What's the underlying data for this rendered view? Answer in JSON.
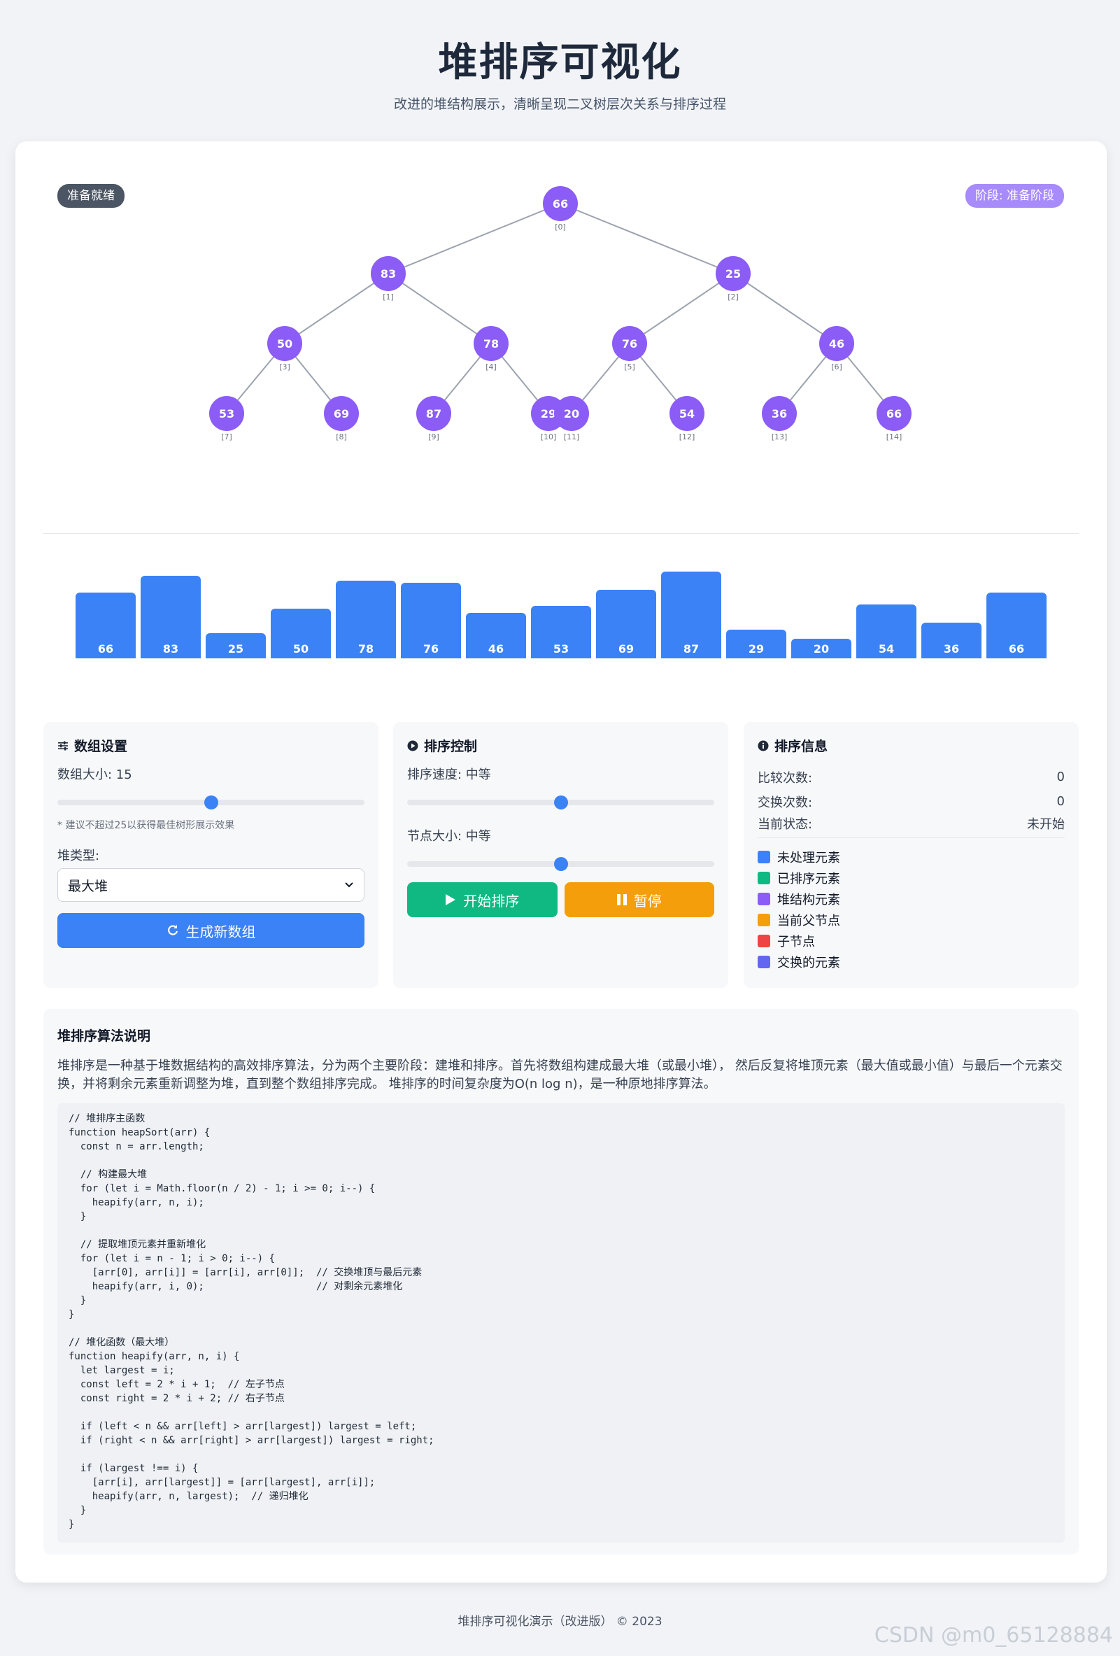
{
  "header": {
    "title": "堆排序可视化",
    "subtitle": "改进的堆结构展示，清晰呈现二叉树层次关系与排序过程"
  },
  "tree": {
    "status_badge": "准备就绪",
    "phase_badge": "阶段: 准备阶段",
    "node_color": "#8b5cf6",
    "edge_color": "#9ca3af",
    "nodes": [
      {
        "value": "66",
        "index": "[0]"
      },
      {
        "value": "83",
        "index": "[1]"
      },
      {
        "value": "25",
        "index": "[2]"
      },
      {
        "value": "50",
        "index": "[3]"
      },
      {
        "value": "78",
        "index": "[4]"
      },
      {
        "value": "76",
        "index": "[5]"
      },
      {
        "value": "46",
        "index": "[6]"
      },
      {
        "value": "53",
        "index": "[7]"
      },
      {
        "value": "69",
        "index": "[8]"
      },
      {
        "value": "87",
        "index": "[9]"
      },
      {
        "value": "29",
        "index": "[10]"
      },
      {
        "value": "20",
        "index": "[11]"
      },
      {
        "value": "54",
        "index": "[12]"
      },
      {
        "value": "36",
        "index": "[13]"
      },
      {
        "value": "66",
        "index": "[14]"
      }
    ]
  },
  "array_values": [
    66,
    83,
    25,
    50,
    78,
    76,
    46,
    53,
    69,
    87,
    29,
    20,
    54,
    36,
    66
  ],
  "bar_color": "#3b82f6",
  "settings": {
    "title": "数组设置",
    "size_label": "数组大小: 15",
    "size_value": 15,
    "size_max": 30,
    "hint": "* 建议不超过25以获得最佳树形展示效果",
    "heap_type_label": "堆类型:",
    "heap_type_value": "最大堆",
    "generate_button": "生成新数组"
  },
  "controls": {
    "title": "排序控制",
    "speed_label": "排序速度: 中等",
    "speed_level": 0.5,
    "node_size_label": "节点大小: 中等",
    "node_size_level": 0.5,
    "start_button": "开始排序",
    "pause_button": "暂停",
    "start_color": "#10b981",
    "pause_color": "#f59e0b"
  },
  "info": {
    "title": "排序信息",
    "comparisons_label": "比较次数:",
    "comparisons_value": "0",
    "swaps_label": "交换次数:",
    "swaps_value": "0",
    "state_label": "当前状态:",
    "state_value": "未开始",
    "legend": [
      {
        "label": "未处理元素",
        "color": "#3b82f6"
      },
      {
        "label": "已排序元素",
        "color": "#10b981"
      },
      {
        "label": "堆结构元素",
        "color": "#8b5cf6"
      },
      {
        "label": "当前父节点",
        "color": "#f59e0b"
      },
      {
        "label": "子节点",
        "color": "#ef4444"
      },
      {
        "label": "交换的元素",
        "color": "#6366f1"
      }
    ]
  },
  "algorithm": {
    "title": "堆排序算法说明",
    "description": "堆排序是一种基于堆数据结构的高效排序算法，分为两个主要阶段：建堆和排序。首先将数组构建成最大堆（或最小堆）， 然后反复将堆顶元素（最大值或最小值）与最后一个元素交换，并将剩余元素重新调整为堆，直到整个数组排序完成。 堆排序的时间复杂度为O(n log n)，是一种原地排序算法。",
    "code": "// 堆排序主函数\nfunction heapSort(arr) {\n  const n = arr.length;\n\n  // 构建最大堆\n  for (let i = Math.floor(n / 2) - 1; i >= 0; i--) {\n    heapify(arr, n, i);\n  }\n\n  // 提取堆顶元素并重新堆化\n  for (let i = n - 1; i > 0; i--) {\n    [arr[0], arr[i]] = [arr[i], arr[0]];  // 交换堆顶与最后元素\n    heapify(arr, i, 0);                   // 对剩余元素堆化\n  }\n}\n\n// 堆化函数（最大堆）\nfunction heapify(arr, n, i) {\n  let largest = i;\n  const left = 2 * i + 1;  // 左子节点\n  const right = 2 * i + 2; // 右子节点\n\n  if (left < n && arr[left] > arr[largest]) largest = left;\n  if (right < n && arr[right] > arr[largest]) largest = right;\n\n  if (largest !== i) {\n    [arr[i], arr[largest]] = [arr[largest], arr[i]];\n    heapify(arr, n, largest);  // 递归堆化\n  }\n}"
  },
  "footer": "堆排序可视化演示（改进版） © 2023",
  "watermark": "CSDN @m0_65128884"
}
